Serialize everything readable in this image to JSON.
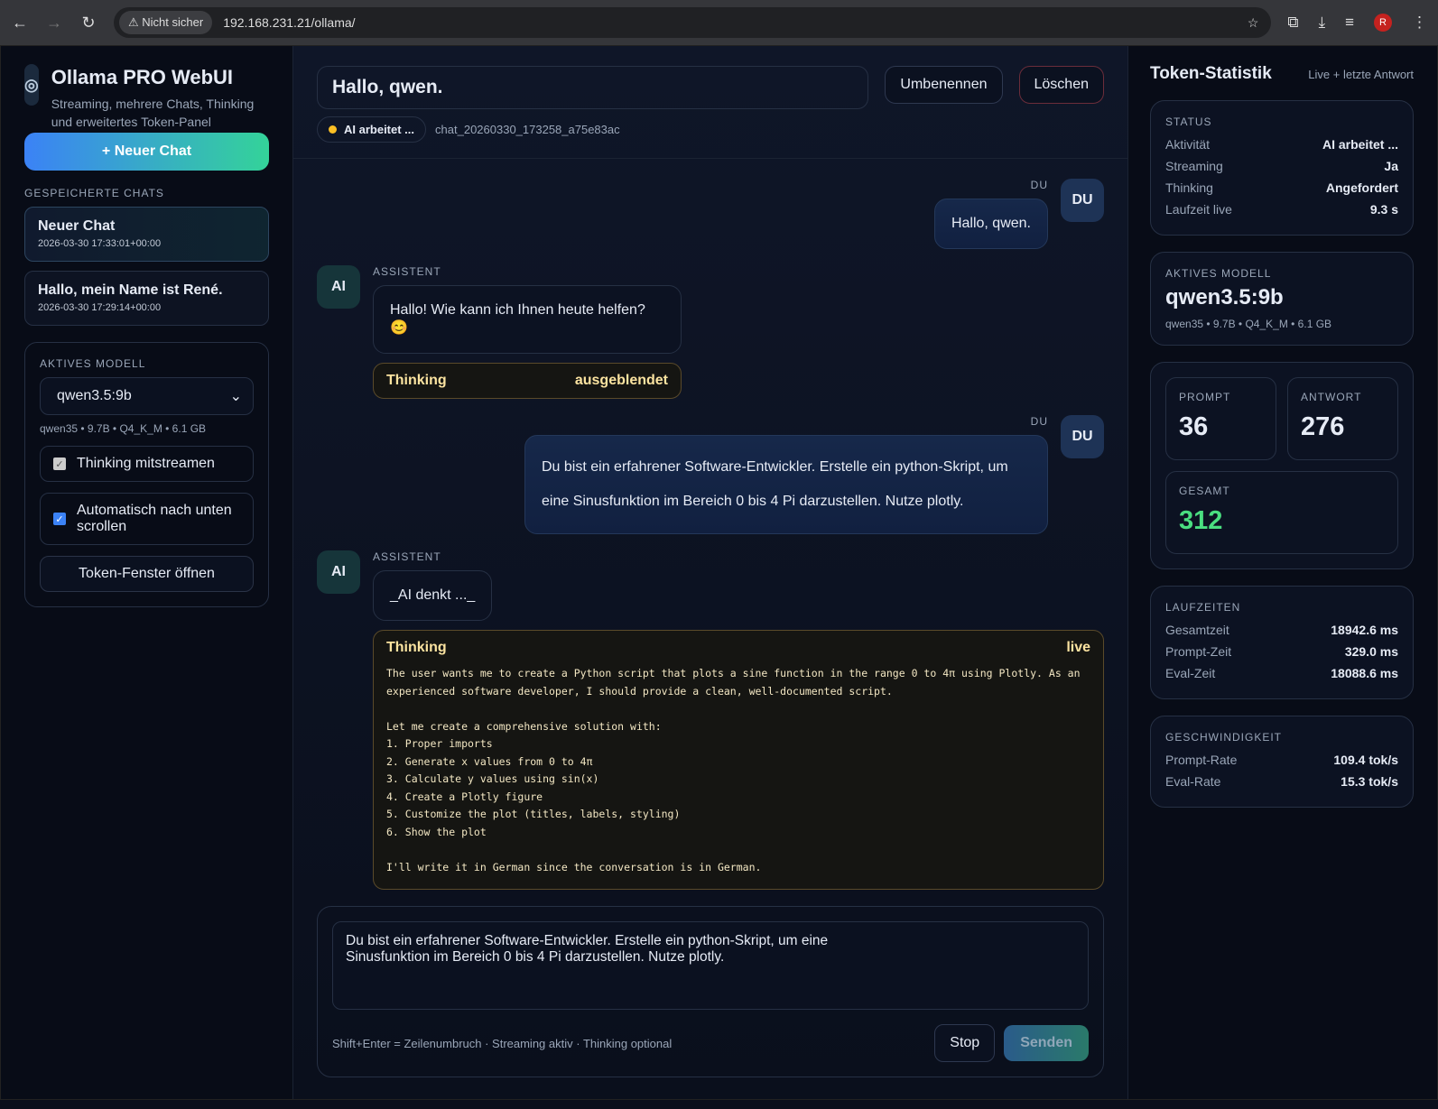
{
  "browser": {
    "url": "192.168.231.21/ollama/",
    "security": "Nicht sicher",
    "profile": "R"
  },
  "sidebar": {
    "title": "Ollama PRO WebUI",
    "subtitle": "Streaming, mehrere Chats, Thinking und erweitertes Token-Panel",
    "new_chat": "+ Neuer Chat",
    "saved_label": "GESPEICHERTE CHATS",
    "chats": [
      {
        "title": "Neuer Chat",
        "date": "2026-03-30 17:33:01+00:00"
      },
      {
        "title": "Hallo, mein Name ist René.",
        "date": "2026-03-30 17:29:14+00:00"
      }
    ],
    "model_label": "AKTIVES MODELL",
    "model": "qwen3.5:9b",
    "model_meta": "qwen35 • 9.7B • Q4_K_M • 6.1 GB",
    "opt_thinking": "Thinking mitstreamen",
    "opt_scroll": "Automatisch nach unten scrollen",
    "token_window": "Token-Fenster öffnen"
  },
  "chat": {
    "title": "Hallo, qwen.",
    "rename": "Umbenennen",
    "delete": "Löschen",
    "status": "AI arbeitet ...",
    "chat_id": "chat_20260330_173258_a75e83ac",
    "user_label": "DU",
    "ai_label": "ASSISTENT",
    "user_avatar": "DU",
    "ai_avatar": "AI",
    "messages": [
      {
        "text": "Hallo, qwen."
      },
      {
        "text": "Hallo! Wie kann ich Ihnen heute helfen? 😊",
        "thinking_title": "Thinking",
        "thinking_state": "ausgeblendet"
      },
      {
        "text": "Du bist ein erfahrener Software-Entwickler. Erstelle ein python-Skript, um eine Sinusfunktion im Bereich 0 bis 4 Pi darzustellen. Nutze plotly."
      },
      {
        "text": "_AI denkt ..._",
        "thinking_title": "Thinking",
        "thinking_state": "live",
        "thinking": "The user wants me to create a Python script that plots a sine function in the range 0 to 4π using Plotly. As an experienced software developer, I should provide a clean, well-documented script.\n\nLet me create a comprehensive solution with:\n1. Proper imports\n2. Generate x values from 0 to 4π\n3. Calculate y values using sin(x)\n4. Create a Plotly figure\n5. Customize the plot (titles, labels, styling)\n6. Show the plot\n\nI'll write it in German since the conversation is in German."
      }
    ],
    "input": "Du bist ein erfahrener Software-Entwickler. Erstelle ein python-Skript, um eine\nSinusfunktion im Bereich 0 bis 4 Pi darzustellen. Nutze plotly.",
    "hint": "Shift+Enter = Zeilenumbruch · Streaming aktiv · Thinking optional",
    "stop": "Stop",
    "send": "Senden"
  },
  "stats": {
    "title": "Token-Statistik",
    "subtitle": "Live + letzte Antwort",
    "status_label": "STATUS",
    "status": [
      [
        "Aktivität",
        "AI arbeitet ..."
      ],
      [
        "Streaming",
        "Ja"
      ],
      [
        "Thinking",
        "Angefordert"
      ],
      [
        "Laufzeit live",
        "9.3 s"
      ]
    ],
    "model_label": "AKTIVES MODELL",
    "model": "qwen3.5:9b",
    "model_meta": "qwen35 • 9.7B • Q4_K_M • 6.1 GB",
    "prompt_label": "PROMPT",
    "prompt": "36",
    "answer_label": "ANTWORT",
    "answer": "276",
    "total_label": "GESAMT",
    "total": "312",
    "times_label": "LAUFZEITEN",
    "times": [
      [
        "Gesamtzeit",
        "18942.6 ms"
      ],
      [
        "Prompt-Zeit",
        "329.0 ms"
      ],
      [
        "Eval-Zeit",
        "18088.6 ms"
      ]
    ],
    "speed_label": "GESCHWINDIGKEIT",
    "speed": [
      [
        "Prompt-Rate",
        "109.4 tok/s"
      ],
      [
        "Eval-Rate",
        "15.3 tok/s"
      ]
    ]
  }
}
